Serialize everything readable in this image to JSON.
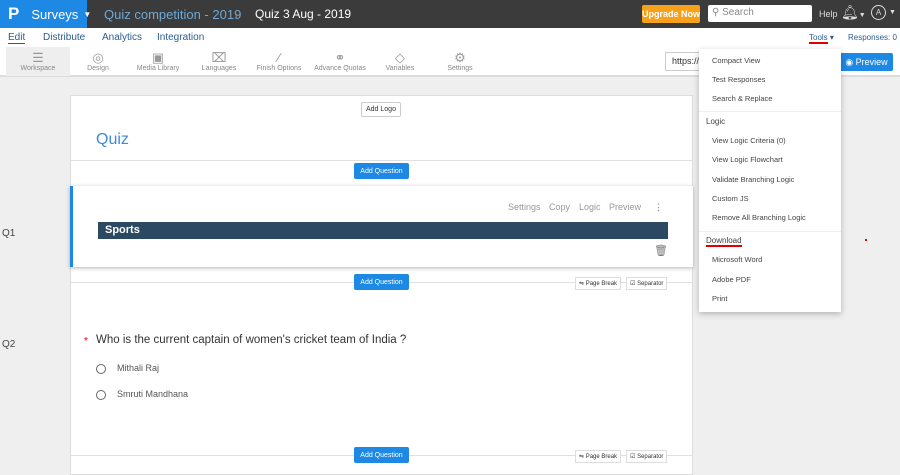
{
  "header": {
    "logo": "P",
    "app": "Surveys",
    "breadcrumb": [
      "Quiz competition - 2019",
      "Quiz 3 Aug - 2019"
    ],
    "upgrade": "Upgrade Now",
    "search_placeholder": "Search",
    "help": "Help",
    "avatar": "A"
  },
  "nav": {
    "tabs": [
      "Edit",
      "Distribute",
      "Analytics",
      "Integration"
    ],
    "tools": "Tools",
    "responses": "Responses: 0"
  },
  "toolbar": {
    "items": [
      {
        "label": "Workspace",
        "icon": "list-icon"
      },
      {
        "label": "Design",
        "icon": "palette-icon"
      },
      {
        "label": "Media Library",
        "icon": "image-icon"
      },
      {
        "label": "Languages",
        "icon": "translate-icon"
      },
      {
        "label": "Finish Options",
        "icon": "magic-wand-icon"
      },
      {
        "label": "Advance Quotas",
        "icon": "quota-icon"
      },
      {
        "label": "Variables",
        "icon": "tag-icon"
      },
      {
        "label": "Settings",
        "icon": "gear-icon"
      }
    ],
    "url": "https://",
    "preview": "Preview"
  },
  "survey": {
    "add_logo": "Add Logo",
    "title": "Quiz",
    "add_question": "Add Question",
    "page_break": "Page Break",
    "separator": "Separator",
    "q1": {
      "label": "Q1",
      "actions": [
        "Settings",
        "Copy",
        "Logic",
        "Preview"
      ],
      "text": "Sports"
    },
    "q2": {
      "label": "Q2",
      "required": "*",
      "text": "Who is the current captain of women's cricket team of India ?",
      "options": [
        "Mithali Raj",
        "Smruti Mandhana"
      ]
    }
  },
  "tools_menu": {
    "items1": [
      "Compact View",
      "Test Responses",
      "Search & Replace"
    ],
    "logic_header": "Logic",
    "logic": [
      "View Logic Criteria (0)",
      "View Logic Flowchart",
      "Validate Branching Logic",
      "Custom JS",
      "Remove All Branching Logic"
    ],
    "download_header": "Download",
    "download": [
      "Microsoft Word",
      "Adobe PDF",
      "Print"
    ]
  },
  "colors": {
    "brand": "#1e88e5",
    "upgrade": "#f7a11a",
    "question_bar": "#2c4964",
    "annotation": "#e00000"
  }
}
